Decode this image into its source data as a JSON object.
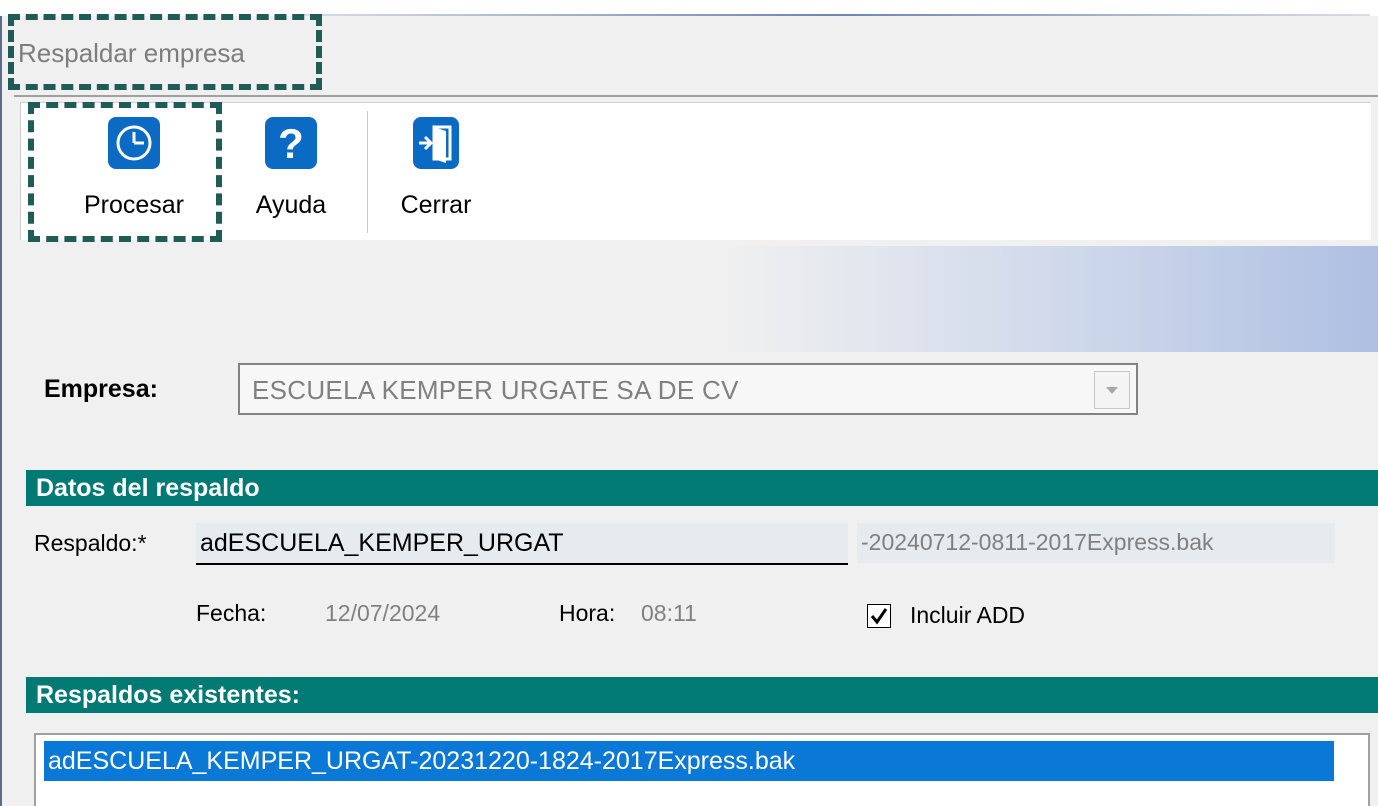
{
  "window": {
    "title": "Respaldar empresa"
  },
  "toolbar": {
    "buttons": [
      {
        "label": "Procesar",
        "icon": "clock-icon"
      },
      {
        "label": "Ayuda",
        "icon": "help-icon"
      },
      {
        "label": "Cerrar",
        "icon": "exit-door-icon"
      }
    ]
  },
  "form": {
    "empresa_label": "Empresa:",
    "empresa_value": "ESCUELA KEMPER URGATE SA DE CV",
    "section_datos": "Datos del respaldo",
    "respaldo_label": "Respaldo:*",
    "respaldo_value": "adESCUELA_KEMPER_URGAT",
    "respaldo_suffix": "-20240712-0811-2017Express.bak",
    "fecha_label": "Fecha:",
    "fecha_value": "12/07/2024",
    "hora_label": "Hora:",
    "hora_value": "08:11",
    "incluir_add_label": "Incluir ADD",
    "incluir_add_checked": true,
    "section_existentes": "Respaldos existentes:",
    "existentes": [
      "adESCUELA_KEMPER_URGAT-20231220-1824-2017Express.bak"
    ]
  },
  "colors": {
    "section_bg": "#007a73",
    "selection_bg": "#0a78d7",
    "icon_bg": "#0a6ac4",
    "highlight_dash": "#1f5c57"
  }
}
